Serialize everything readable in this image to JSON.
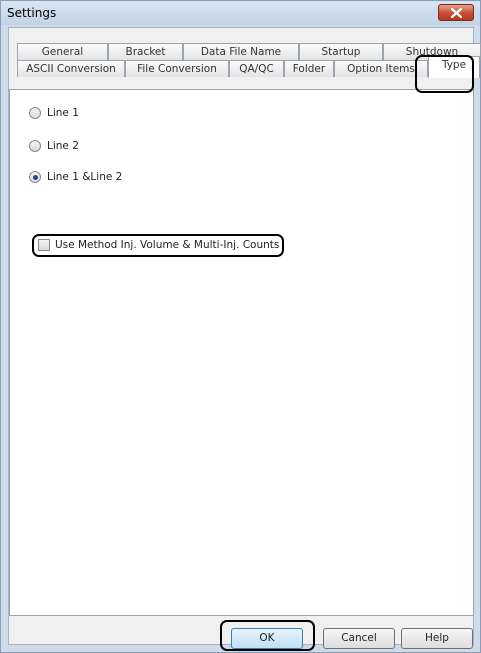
{
  "window": {
    "title": "Settings"
  },
  "tabs_back": [
    {
      "label": "General"
    },
    {
      "label": "Bracket"
    },
    {
      "label": "Data File Name"
    },
    {
      "label": "Startup"
    },
    {
      "label": "Shutdown"
    }
  ],
  "tabs_front": [
    {
      "label": "ASCII Conversion"
    },
    {
      "label": "File Conversion"
    },
    {
      "label": "QA/QC"
    },
    {
      "label": "Folder"
    },
    {
      "label": "Option Items"
    },
    {
      "label": "Type",
      "active": true
    }
  ],
  "type_options": [
    {
      "label": "Line 1",
      "selected": false
    },
    {
      "label": "Line 2",
      "selected": false
    },
    {
      "label": "Line 1 &Line 2",
      "selected": true
    }
  ],
  "use_method_checkbox": {
    "label": "Use Method Inj. Volume & Multi-Inj. Counts",
    "checked": false
  },
  "buttons": {
    "ok": "OK",
    "cancel": "Cancel",
    "help": "Help"
  }
}
